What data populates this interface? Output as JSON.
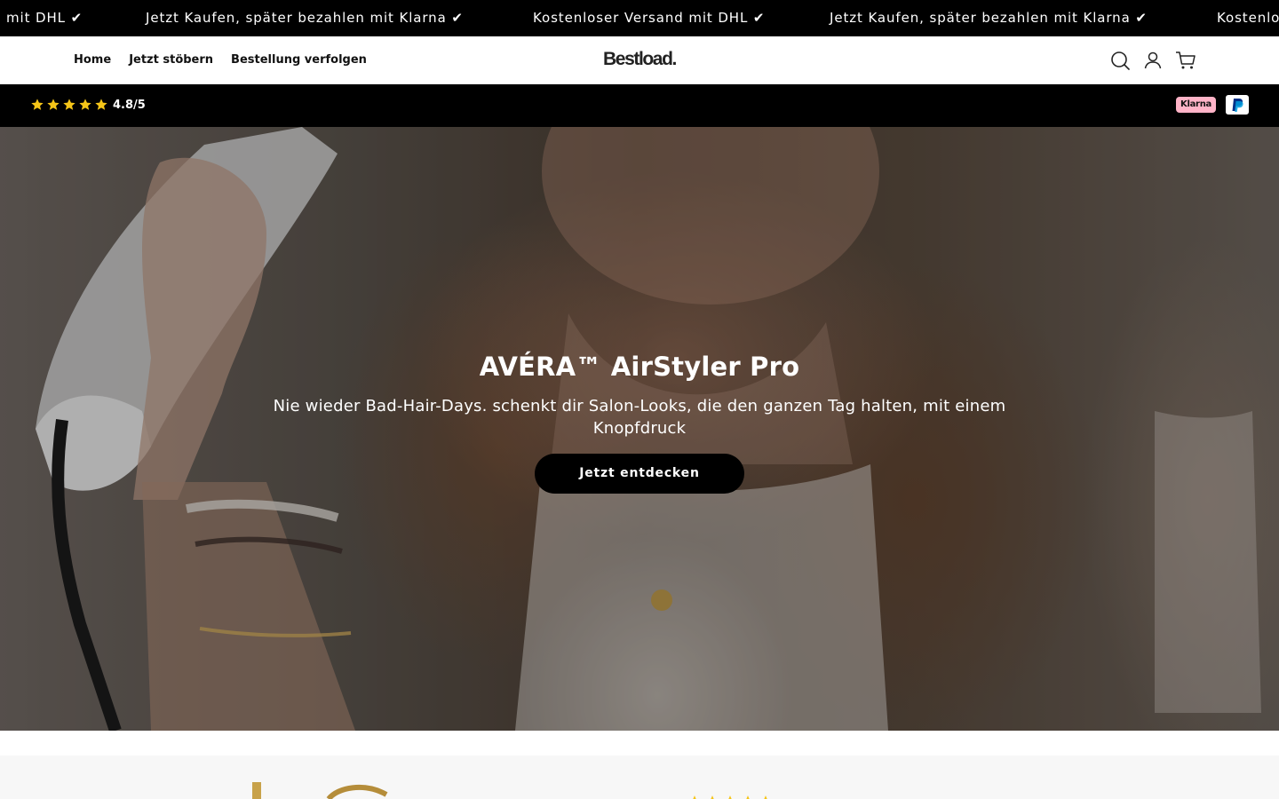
{
  "announcement": {
    "items": [
      "mit DHL ✔",
      "Jetzt Kaufen, später bezahlen mit Klarna ✔",
      "Kostenloser Versand mit DHL ✔",
      "Jetzt Kaufen, später bezahlen mit Klarna ✔",
      "Kostenlo"
    ]
  },
  "header": {
    "nav": [
      {
        "label": "Home"
      },
      {
        "label": "Jetzt stöbern"
      },
      {
        "label": "Bestellung verfolgen"
      }
    ],
    "logo": "Bestload.",
    "icons": [
      "search-icon",
      "account-icon",
      "cart-icon"
    ]
  },
  "trust_bar": {
    "stars": 5,
    "rating": "4.8/5",
    "star_color": "#f5c518",
    "payments": {
      "klarna": "Klarna",
      "paypal_icon": "paypal-icon"
    }
  },
  "hero": {
    "title": "AVÉRA™ AirStyler Pro",
    "subtitle": "Nie wieder Bad-Hair-Days. schenkt dir Salon-Looks, die den ganzen Tag halten, mit einem Knopfdruck",
    "cta": "Jetzt entdecken"
  },
  "colors": {
    "bar_background": "#000000",
    "klarna_pink": "#ffb3c7",
    "paypal_blue": "#003087"
  }
}
